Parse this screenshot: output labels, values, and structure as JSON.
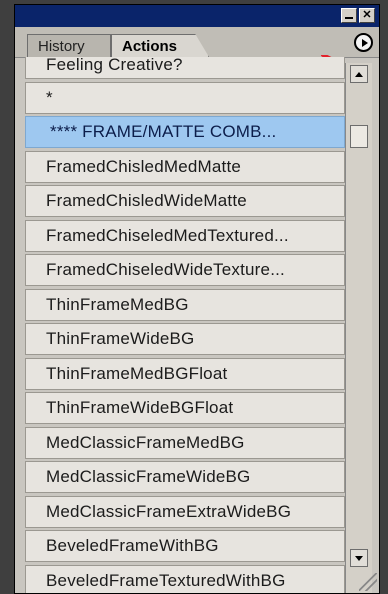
{
  "panel": {
    "tabs": [
      {
        "label": "History",
        "active": false
      },
      {
        "label": "Actions",
        "active": true
      }
    ],
    "titlebar_buttons": [
      "minimize-icon",
      "close-icon"
    ],
    "close_glyph": "✕",
    "menu_icon": "play-circle-icon",
    "annotation_color": "#e3202a"
  },
  "actions": [
    {
      "label": "Feeling Creative?"
    },
    {
      "label": "*"
    },
    {
      "label": "****   FRAME/MATTE COMB...",
      "selected": true
    },
    {
      "label": "FramedChisledMedMatte"
    },
    {
      "label": "FramedChisledWideMatte"
    },
    {
      "label": "FramedChiseledMedTextured..."
    },
    {
      "label": "FramedChiseledWideTexture..."
    },
    {
      "label": "ThinFrameMedBG"
    },
    {
      "label": "ThinFrameWideBG"
    },
    {
      "label": "ThinFrameMedBGFloat"
    },
    {
      "label": "ThinFrameWideBGFloat"
    },
    {
      "label": "MedClassicFrameMedBG"
    },
    {
      "label": "MedClassicFrameWideBG"
    },
    {
      "label": "MedClassicFrameExtraWideBG"
    },
    {
      "label": "BeveledFrameWithBG"
    },
    {
      "label": "BeveledFrameTexturedWithBG"
    }
  ],
  "colors": {
    "titlebar": "#0a246a",
    "selected_row": "#9ec8f0"
  }
}
